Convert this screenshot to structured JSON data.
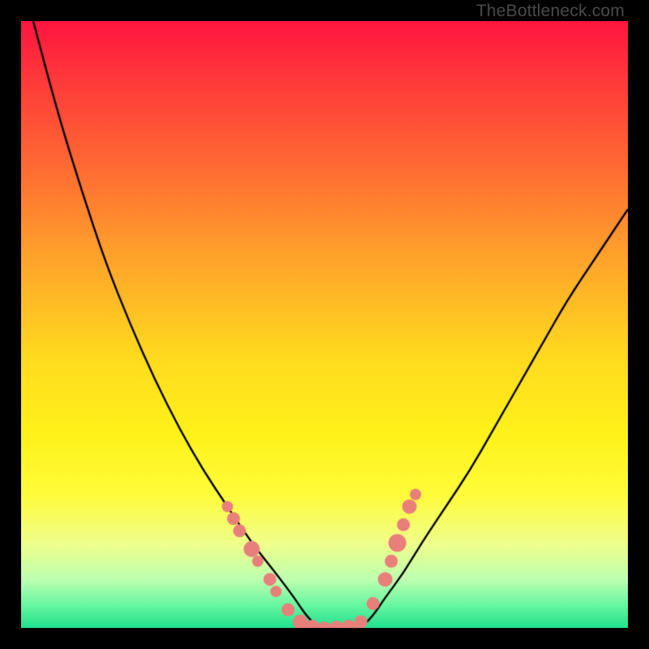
{
  "watermark": "TheBottleneck.com",
  "chart_data": {
    "type": "line",
    "title": "",
    "xlabel": "",
    "ylabel": "",
    "xlim": [
      0,
      100
    ],
    "ylim": [
      0,
      100
    ],
    "background_gradient": {
      "stops": [
        {
          "pos": 0.0,
          "color": "#ff153f"
        },
        {
          "pos": 0.1,
          "color": "#ff3a3a"
        },
        {
          "pos": 0.25,
          "color": "#ff6e33"
        },
        {
          "pos": 0.4,
          "color": "#ffa72a"
        },
        {
          "pos": 0.55,
          "color": "#ffd91f"
        },
        {
          "pos": 0.68,
          "color": "#fff21a"
        },
        {
          "pos": 0.78,
          "color": "#fffc3a"
        },
        {
          "pos": 0.86,
          "color": "#f0ff8a"
        },
        {
          "pos": 0.92,
          "color": "#beffb0"
        },
        {
          "pos": 0.96,
          "color": "#6cf7a2"
        },
        {
          "pos": 1.0,
          "color": "#22e18e"
        }
      ]
    },
    "series": [
      {
        "name": "left-curve",
        "x": [
          2,
          6,
          10,
          14,
          18,
          22,
          26,
          30,
          34,
          38,
          42,
          45,
          47,
          49
        ],
        "values": [
          100,
          85,
          72,
          60,
          50,
          41,
          33,
          26,
          20,
          14,
          9,
          5,
          2,
          0
        ]
      },
      {
        "name": "right-curve",
        "x": [
          56,
          58,
          60,
          63,
          66,
          70,
          74,
          78,
          82,
          86,
          90,
          94,
          98,
          100
        ],
        "values": [
          0,
          2,
          5,
          9,
          14,
          20,
          26,
          33,
          40,
          47,
          54,
          60,
          66,
          69
        ]
      }
    ],
    "markers": {
      "name": "data-points",
      "color": "#e97f7a",
      "radius_px_range": [
        6,
        11
      ],
      "points": [
        {
          "x": 34,
          "y": 20,
          "r": 7
        },
        {
          "x": 35,
          "y": 18,
          "r": 8
        },
        {
          "x": 36,
          "y": 16,
          "r": 8
        },
        {
          "x": 38,
          "y": 13,
          "r": 10
        },
        {
          "x": 39,
          "y": 11,
          "r": 7
        },
        {
          "x": 41,
          "y": 8,
          "r": 8
        },
        {
          "x": 42,
          "y": 6,
          "r": 7
        },
        {
          "x": 44,
          "y": 3,
          "r": 8
        },
        {
          "x": 46,
          "y": 1,
          "r": 9
        },
        {
          "x": 48,
          "y": 0,
          "r": 10
        },
        {
          "x": 50,
          "y": 0,
          "r": 8
        },
        {
          "x": 52,
          "y": 0,
          "r": 9
        },
        {
          "x": 54,
          "y": 0,
          "r": 10
        },
        {
          "x": 56,
          "y": 1,
          "r": 8
        },
        {
          "x": 58,
          "y": 4,
          "r": 8
        },
        {
          "x": 60,
          "y": 8,
          "r": 9
        },
        {
          "x": 61,
          "y": 11,
          "r": 8
        },
        {
          "x": 62,
          "y": 14,
          "r": 11
        },
        {
          "x": 63,
          "y": 17,
          "r": 8
        },
        {
          "x": 64,
          "y": 20,
          "r": 9
        },
        {
          "x": 65,
          "y": 22,
          "r": 7
        }
      ]
    }
  }
}
